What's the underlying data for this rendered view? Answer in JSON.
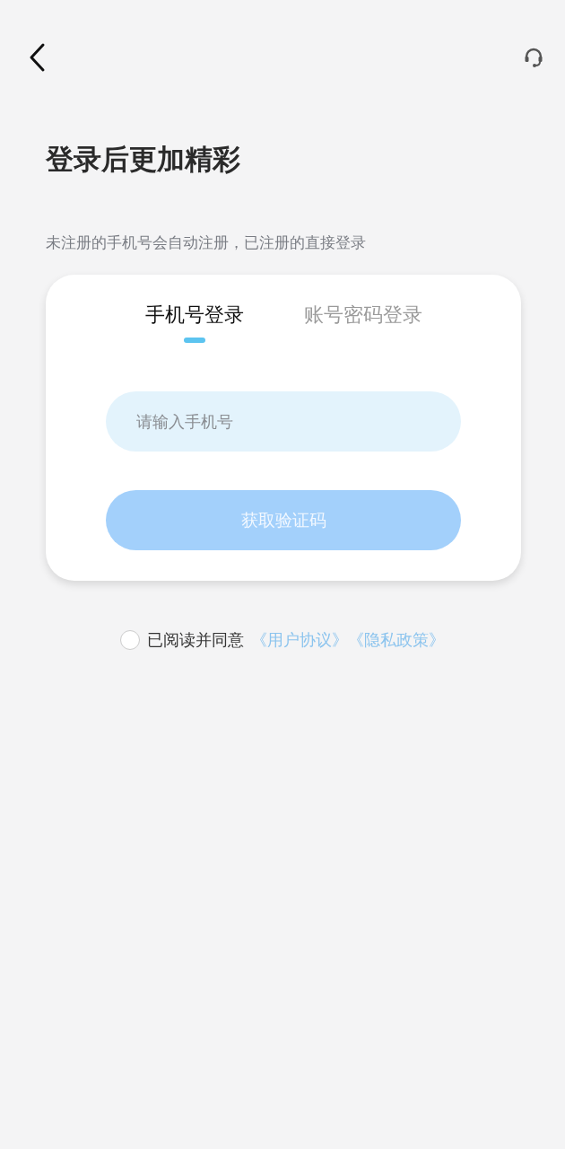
{
  "title": "登录后更加精彩",
  "subtitle": "未注册的手机号会自动注册，已注册的直接登录",
  "tabs": [
    {
      "label": "手机号登录",
      "selected": true
    },
    {
      "label": "账号密码登录",
      "selected": false
    }
  ],
  "phone_field": {
    "placeholder": "请输入手机号"
  },
  "submit_button": {
    "label": "获取验证码",
    "disabled": true
  },
  "agreement": {
    "checked": false,
    "text": "已阅读并同意",
    "links": [
      "《用户协议》",
      "《隐私政策》"
    ]
  }
}
